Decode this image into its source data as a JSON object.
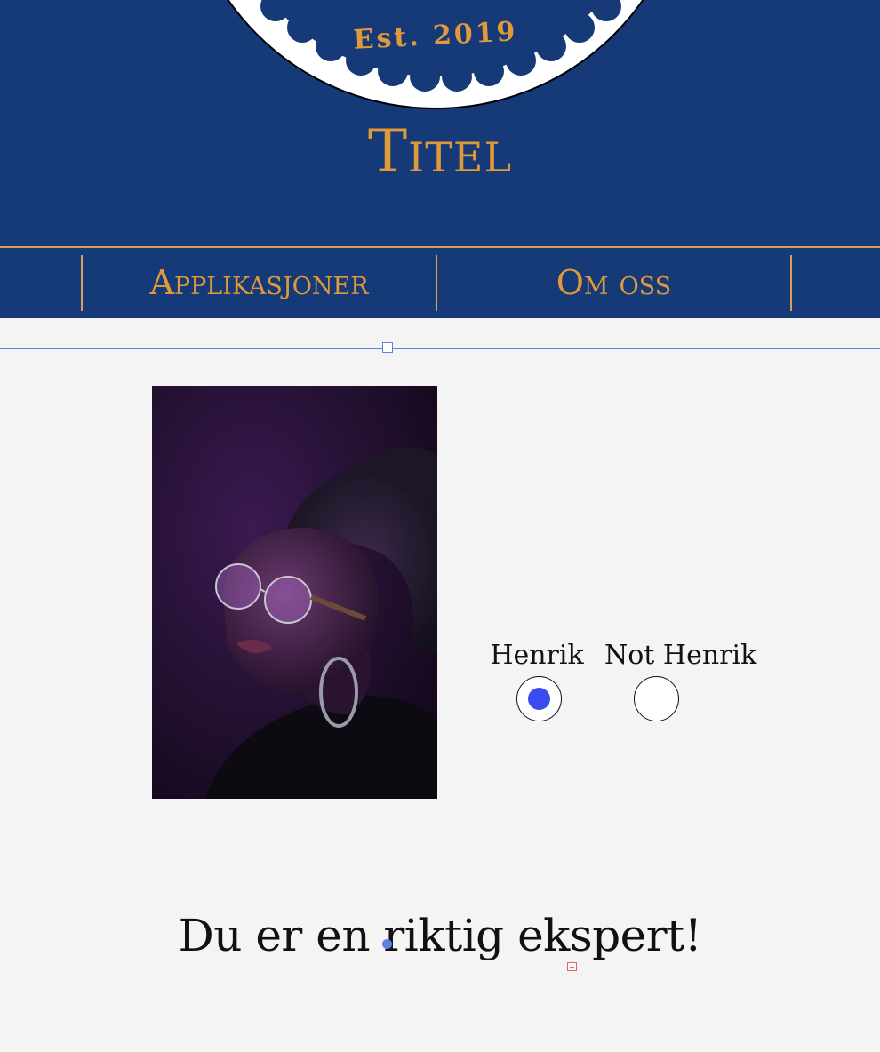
{
  "header": {
    "logo_text": "Est. 2019",
    "title": "Titel"
  },
  "nav": {
    "items": [
      {
        "label": "Applikasjoner"
      },
      {
        "label": "Om oss"
      }
    ]
  },
  "quiz": {
    "options": [
      {
        "label": "Henrik",
        "selected": true
      },
      {
        "label": "Not Henrik",
        "selected": false
      }
    ],
    "result_text": "Du er en riktig ekspert!"
  },
  "colors": {
    "header_bg": "#163a78",
    "accent_gold": "#e09a3a",
    "radio_selected": "#3a4cf0",
    "selection_blue": "#5b83e6",
    "page_bg": "#f4f4f4"
  },
  "icons": {
    "image_subject": "portrait-woman-with-glasses",
    "editor_handle": "selection-handle-icon",
    "add_block": "add-block-icon"
  }
}
